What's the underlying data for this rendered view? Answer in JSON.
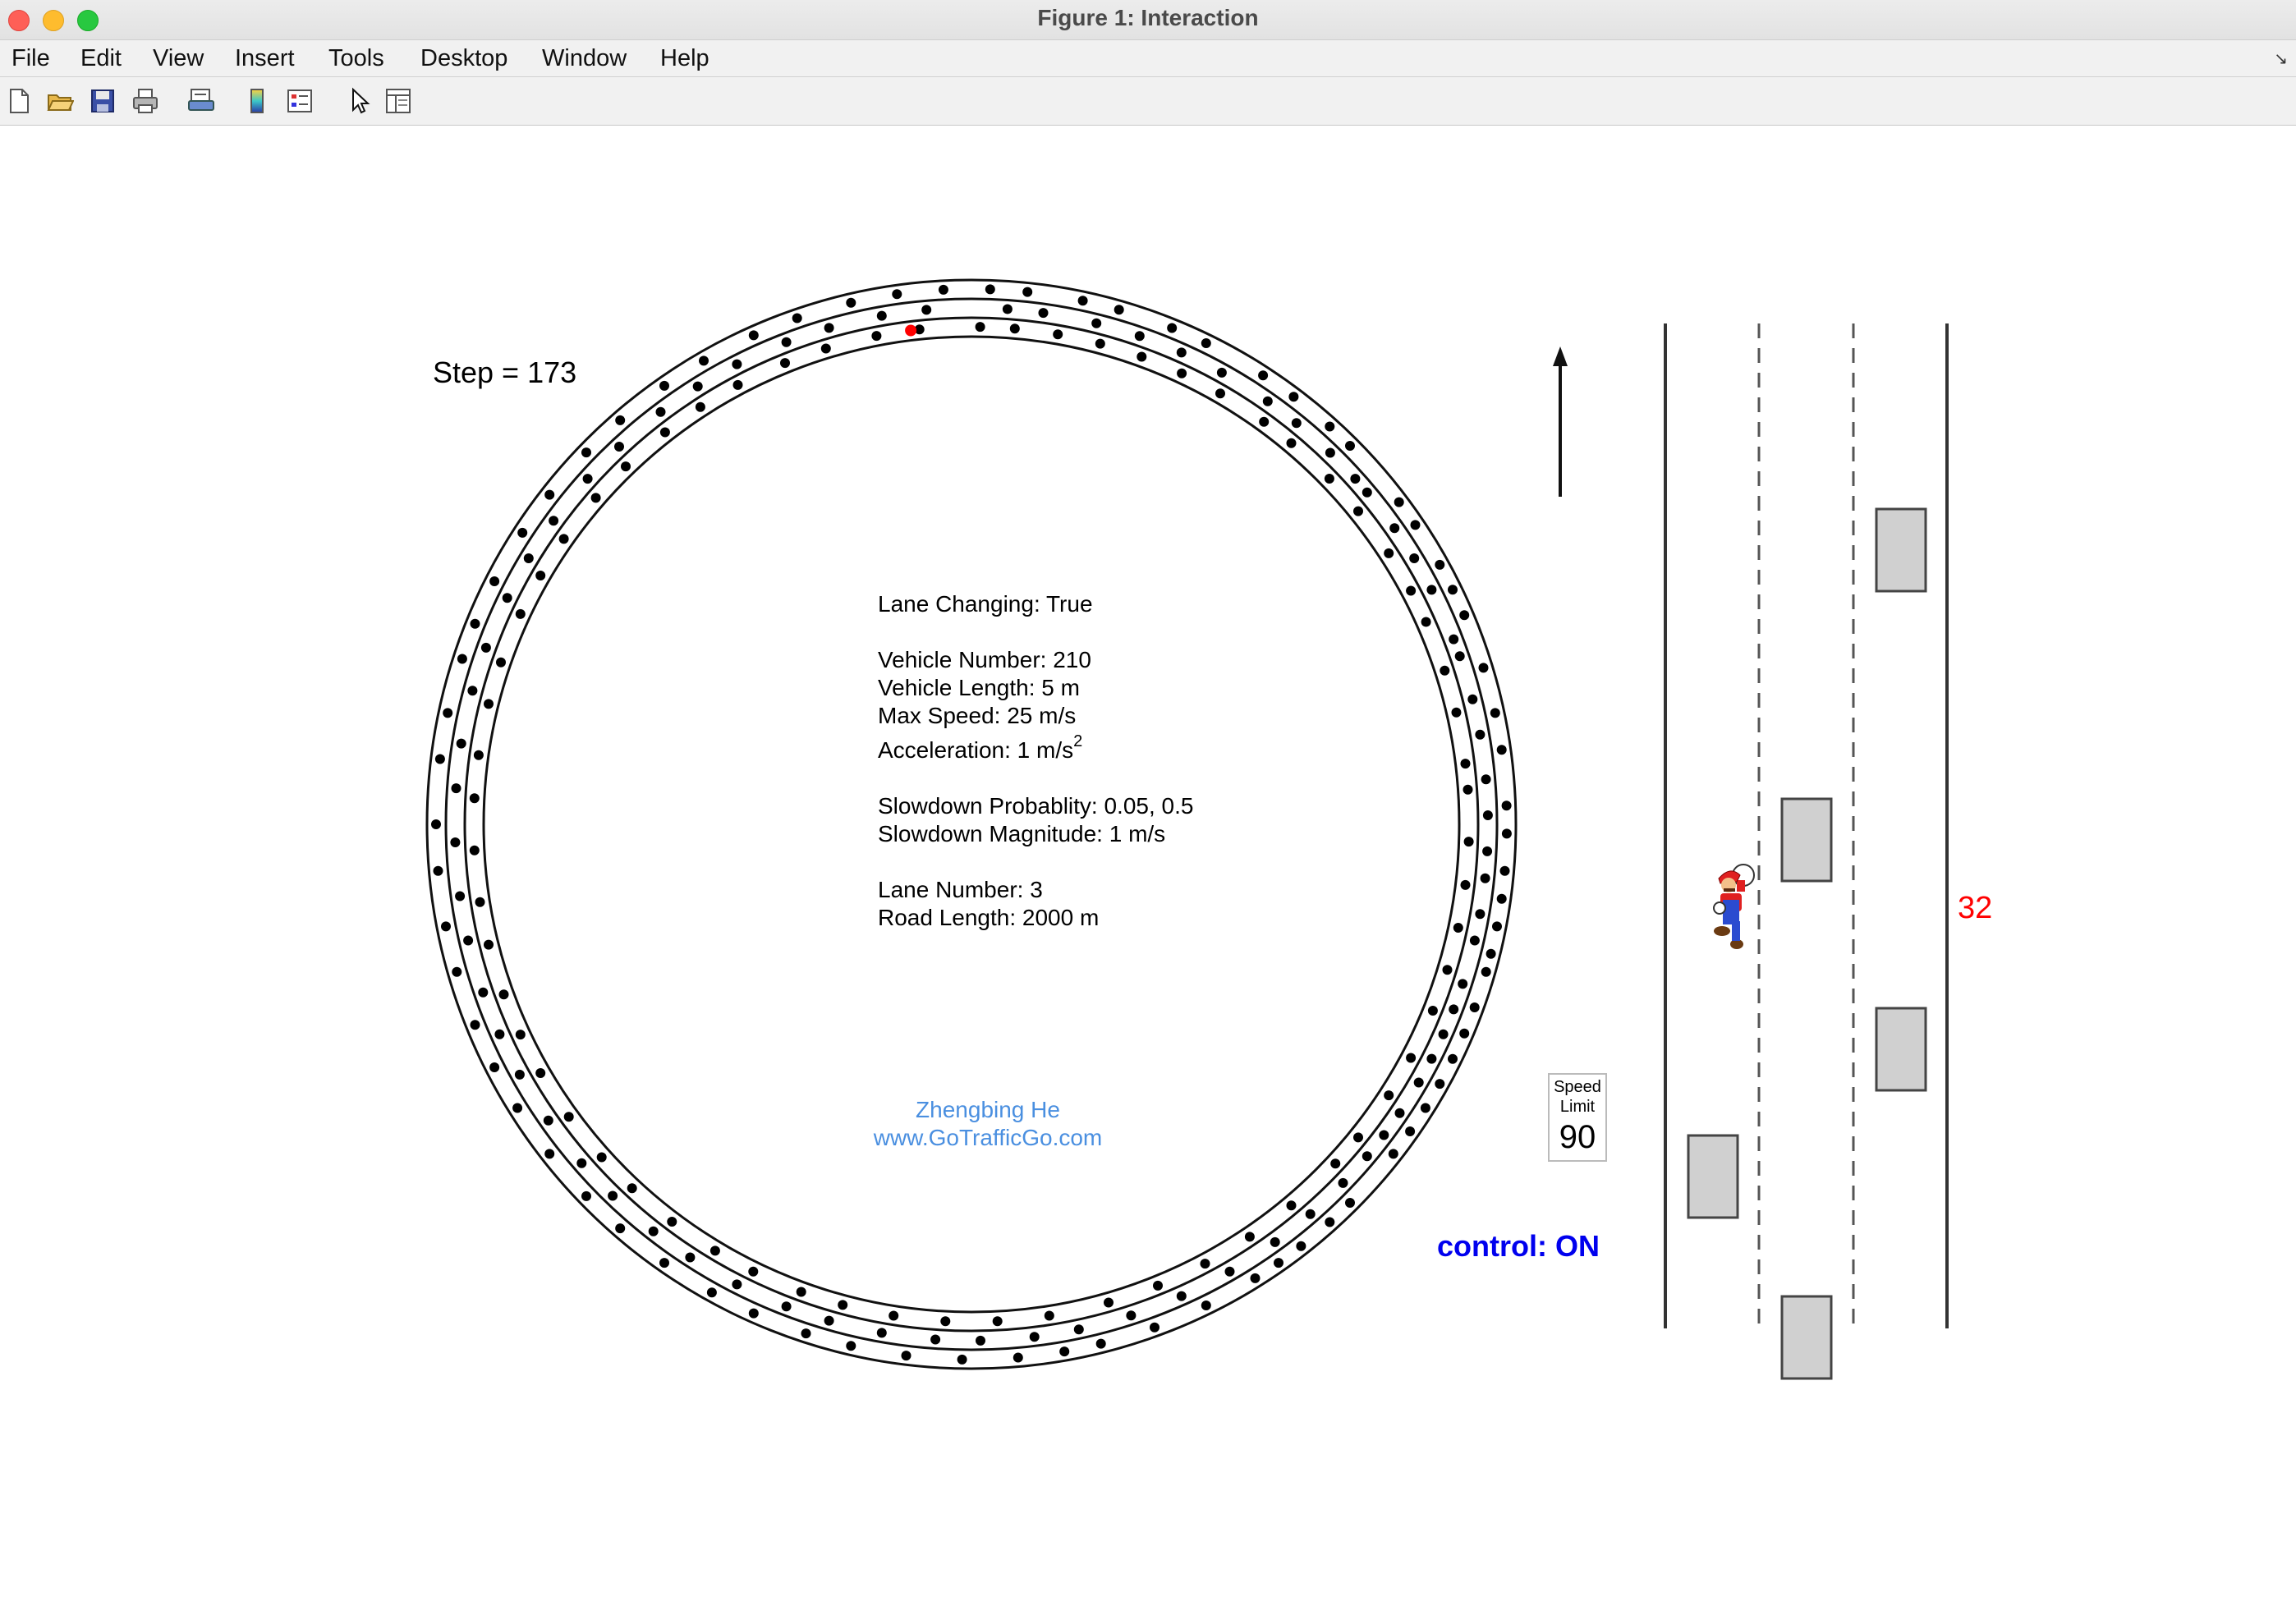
{
  "window": {
    "title": "Figure 1: Interaction"
  },
  "menu": {
    "file": "File",
    "edit": "Edit",
    "view": "View",
    "insert": "Insert",
    "tools": "Tools",
    "desktop": "Desktop",
    "window": "Window",
    "help": "Help"
  },
  "toolbar": {
    "icons": [
      "new-figure-icon",
      "open-folder-icon",
      "save-disk-icon",
      "print-icon",
      "print-preview-icon",
      "colorbar-icon",
      "legend-icon",
      "pointer-arrow-icon",
      "property-editor-icon"
    ]
  },
  "figure": {
    "step_label": "Step = 173",
    "info": {
      "lane_changing": "Lane Changing: True",
      "vehicle_number": "Vehicle Number: 210",
      "vehicle_length": "Vehicle Length: 5 m",
      "max_speed": "Max Speed: 25 m/s",
      "acceleration": "Acceleration: 1 m/s",
      "acceleration_exp": "2",
      "slowdown_prob": "Slowdown Probablity: 0.05, 0.5",
      "slowdown_mag": "Slowdown Magnitude: 1 m/s",
      "lane_number": "Lane Number: 3",
      "road_length": "Road Length: 2000 m"
    },
    "credit": {
      "author": "Zhengbing He",
      "website": "www.GoTrafficGo.com"
    },
    "speed_sign": {
      "line1": "Speed",
      "line2": "Limit",
      "value": "90"
    },
    "control_label": "control: ON",
    "speed_readout": "32",
    "colors": {
      "vehicle": "#000000",
      "highlight_vehicle": "#ff0000",
      "credit": "#4a8fe0",
      "control": "#0000ee",
      "speed": "#ff0000",
      "car_fill": "#d0d0d0"
    },
    "ring_vehicles": {
      "lane1": [
        2,
        6,
        12,
        16,
        22,
        26,
        33,
        37,
        42,
        45,
        53,
        56,
        61,
        64,
        67,
        73,
        78,
        82,
        88,
        91,
        95,
        98,
        101,
        104,
        106,
        110,
        113,
        116,
        119,
        122,
        125,
        128,
        135,
        138,
        142,
        145,
        148,
        154,
        160,
        166,
        170,
        175,
        181,
        187,
        193,
        198,
        204,
        209,
        215,
        221,
        226,
        232,
        238,
        243,
        248,
        254,
        259,
        265,
        270,
        277,
        282,
        288,
        292,
        297,
        303,
        308,
        314,
        319,
        325,
        330,
        336,
        341,
        347,
        352,
        357
      ],
      "lane2": [
        4,
        8,
        14,
        19,
        24,
        29,
        35,
        39,
        44,
        48,
        50,
        55,
        59,
        63,
        69,
        71,
        76,
        80,
        85,
        89,
        93,
        96,
        100,
        103,
        108,
        111,
        114,
        117,
        120,
        124,
        127,
        130,
        134,
        139,
        144,
        150,
        156,
        162,
        168,
        173,
        179,
        184,
        190,
        196,
        201,
        207,
        213,
        218,
        224,
        229,
        235,
        241,
        246,
        251,
        257,
        262,
        268,
        274,
        279,
        285,
        290,
        296,
        301,
        306,
        312,
        317,
        323,
        328,
        333,
        339,
        344,
        350,
        355
      ],
      "lane3": [
        1,
        5,
        10,
        15,
        20,
        25,
        30,
        36,
        40,
        46,
        51,
        57,
        62,
        66,
        72,
        77,
        83,
        86,
        92,
        97,
        102,
        107,
        112,
        118,
        123,
        129,
        133,
        140,
        146,
        152,
        158,
        164,
        171,
        177,
        183,
        189,
        195,
        200,
        206,
        211,
        217,
        223,
        228,
        234,
        240,
        245,
        250,
        256,
        261,
        267,
        273,
        278,
        284,
        289,
        295,
        300,
        305,
        311,
        316,
        322,
        327,
        332,
        338,
        343,
        349,
        354
      ],
      "highlight_lane": 3,
      "highlight_angle": 353
    }
  }
}
